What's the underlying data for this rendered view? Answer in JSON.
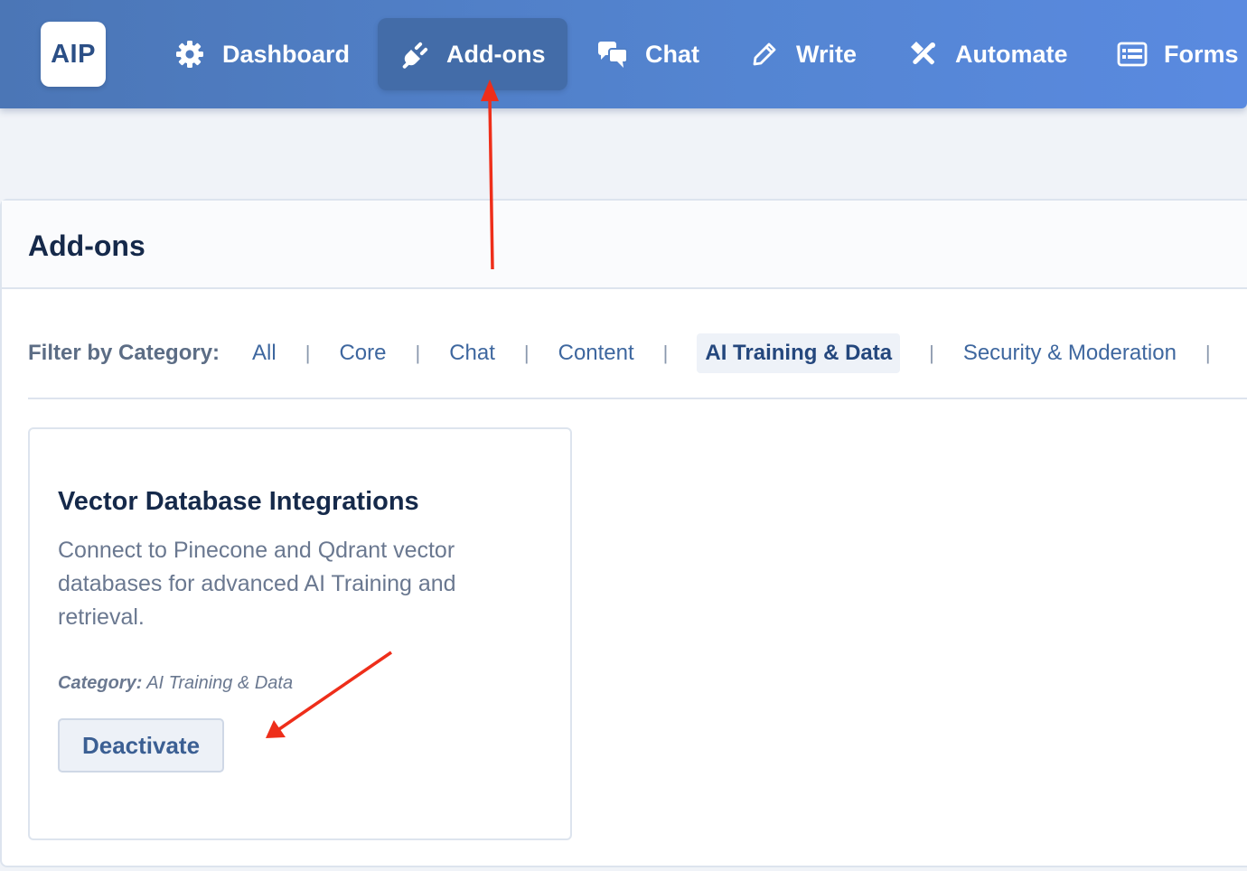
{
  "logo": {
    "text": "AIP"
  },
  "nav": {
    "dashboard": {
      "label": "Dashboard",
      "icon": "gear-icon"
    },
    "addons": {
      "label": "Add-ons",
      "icon": "plug-icon",
      "active": true
    },
    "chat": {
      "label": "Chat",
      "icon": "chat-bubbles-icon"
    },
    "write": {
      "label": "Write",
      "icon": "pencil-icon"
    },
    "automate": {
      "label": "Automate",
      "icon": "automation-icon"
    },
    "forms": {
      "label": "Forms",
      "icon": "form-icon"
    }
  },
  "page": {
    "title": "Add-ons"
  },
  "filter": {
    "label": "Filter by Category:",
    "categories": [
      "All",
      "Core",
      "Chat",
      "Content",
      "AI Training & Data",
      "Security & Moderation"
    ],
    "active": "AI Training & Data",
    "separator": "|"
  },
  "addon": {
    "title": "Vector Database Integrations",
    "description": "Connect to Pinecone and Qdrant vector databases for advanced AI Training and retrieval.",
    "category_key": "Category:",
    "category_value": "AI Training & Data",
    "button_label": "Deactivate"
  },
  "colors": {
    "nav_gradient_start": "#4b76b6",
    "nav_gradient_end": "#5a8ae0",
    "active_nav": "#436ca8",
    "annotation_arrow": "#ee2e1a",
    "title_text": "#15294a",
    "link_text": "#3e679f"
  }
}
